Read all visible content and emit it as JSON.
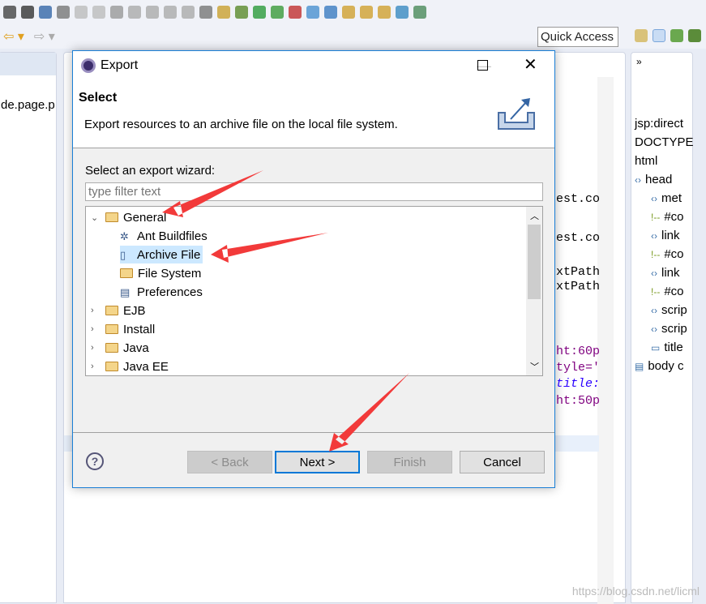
{
  "toolbar": {
    "quick_access": "Quick Access"
  },
  "left_panel": {
    "file_tab": "de.page.p"
  },
  "editor_code": [
    "est.co",
    "est.co",
    "xtPath",
    "xtPath",
    "ht:60p",
    "tyle='",
    "title:",
    "ht:50p"
  ],
  "outline": {
    "items": [
      {
        "label": "jsp:direct",
        "icon": "none",
        "indent": 0
      },
      {
        "label": "DOCTYPE",
        "icon": "none",
        "indent": 0
      },
      {
        "label": "html",
        "icon": "none",
        "indent": 0
      },
      {
        "label": "head",
        "icon": "tag-icon",
        "indent": 0
      },
      {
        "label": "met",
        "icon": "tag-icon",
        "indent": 1
      },
      {
        "label": "#co",
        "icon": "comment-icon",
        "indent": 1
      },
      {
        "label": "link",
        "icon": "tag-icon",
        "indent": 1
      },
      {
        "label": "#co",
        "icon": "comment-icon",
        "indent": 1
      },
      {
        "label": "link",
        "icon": "tag-icon",
        "indent": 1
      },
      {
        "label": "#co",
        "icon": "comment-icon",
        "indent": 1
      },
      {
        "label": "scrip",
        "icon": "tag-icon",
        "indent": 1
      },
      {
        "label": "scrip",
        "icon": "tag-icon",
        "indent": 1
      },
      {
        "label": "title",
        "icon": "title-icon",
        "indent": 1
      },
      {
        "label": "body c",
        "icon": "file-icon",
        "indent": 0
      }
    ]
  },
  "dialog": {
    "title": "Export",
    "header_title": "Select",
    "header_desc": "Export resources to an archive file on the local file system.",
    "wizard_label": "Select an export wizard:",
    "filter_placeholder": "type filter text",
    "tree": [
      {
        "label": "General",
        "expanded": true,
        "level": 0,
        "icon": "folder-open-icon"
      },
      {
        "label": "Ant Buildfiles",
        "level": 1,
        "icon": "ant-icon"
      },
      {
        "label": "Archive File",
        "level": 1,
        "icon": "archive-icon",
        "selected": true
      },
      {
        "label": "File System",
        "level": 1,
        "icon": "folder-icon"
      },
      {
        "label": "Preferences",
        "level": 1,
        "icon": "preferences-icon"
      },
      {
        "label": "EJB",
        "expanded": false,
        "level": 0,
        "icon": "folder-open-icon"
      },
      {
        "label": "Install",
        "expanded": false,
        "level": 0,
        "icon": "folder-open-icon"
      },
      {
        "label": "Java",
        "expanded": false,
        "level": 0,
        "icon": "folder-open-icon"
      },
      {
        "label": "Java EE",
        "expanded": false,
        "level": 0,
        "icon": "folder-open-icon"
      }
    ],
    "buttons": {
      "back": "< Back",
      "next": "Next >",
      "finish": "Finish",
      "cancel": "Cancel"
    }
  },
  "watermark": "https://blog.csdn.net/licml",
  "colors": {
    "accent": "#1a7fd6",
    "selection": "#cce8ff",
    "annotation_arrow": "#f23a3a"
  }
}
